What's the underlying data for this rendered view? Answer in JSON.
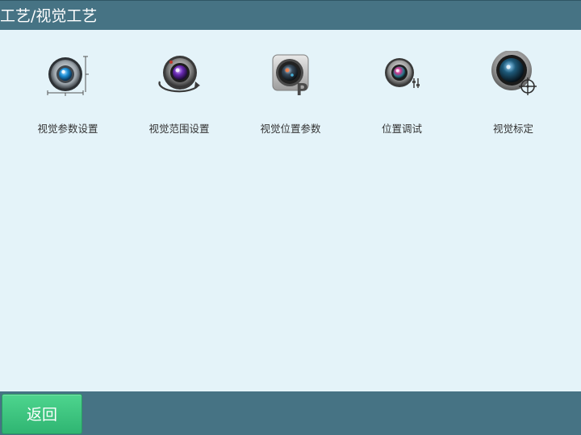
{
  "header": {
    "title": "工艺/视觉工艺"
  },
  "tiles": [
    {
      "label": "视觉参数设置",
      "icon": "lens-dimensions-icon"
    },
    {
      "label": "视觉范围设置",
      "icon": "lens-rotate-icon"
    },
    {
      "label": "视觉位置参数",
      "icon": "camera-position-icon"
    },
    {
      "label": "位置调试",
      "icon": "lens-adjust-icon"
    },
    {
      "label": "视觉标定",
      "icon": "lens-crosshair-icon"
    }
  ],
  "footer": {
    "back_label": "返回"
  },
  "colors": {
    "header_bg": "#467384",
    "content_bg": "#e4f3f9",
    "back_button": "#3cc47f"
  }
}
